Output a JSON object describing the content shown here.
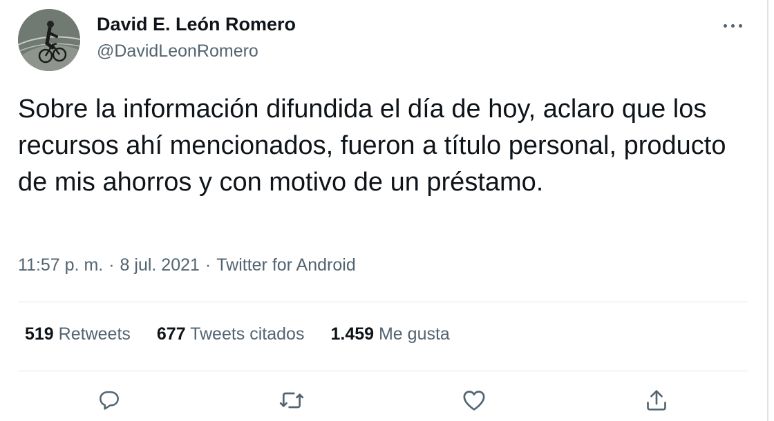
{
  "author": {
    "display_name": "David E. León Romero",
    "handle": "@DavidLeonRomero",
    "avatar_icon": "avatar-cyclist"
  },
  "tweet": {
    "text": "Sobre la información difundida el día de hoy, aclaro que los recursos ahí mencionados, fueron a título personal, producto de mis ahorros y con motivo de un préstamo.",
    "time": "11:57 p. m.",
    "date": "8 jul. 2021",
    "source": "Twitter for Android",
    "separator": "·"
  },
  "stats": {
    "retweets": {
      "count": "519",
      "label": "Retweets"
    },
    "quotes": {
      "count": "677",
      "label": "Tweets citados"
    },
    "likes": {
      "count": "1.459",
      "label": "Me gusta"
    }
  },
  "actions": [
    "reply-icon",
    "retweet-icon",
    "like-icon",
    "share-icon"
  ],
  "colors": {
    "text_primary": "#0f1419",
    "text_secondary": "#536471",
    "divider": "#e1e6ea"
  }
}
